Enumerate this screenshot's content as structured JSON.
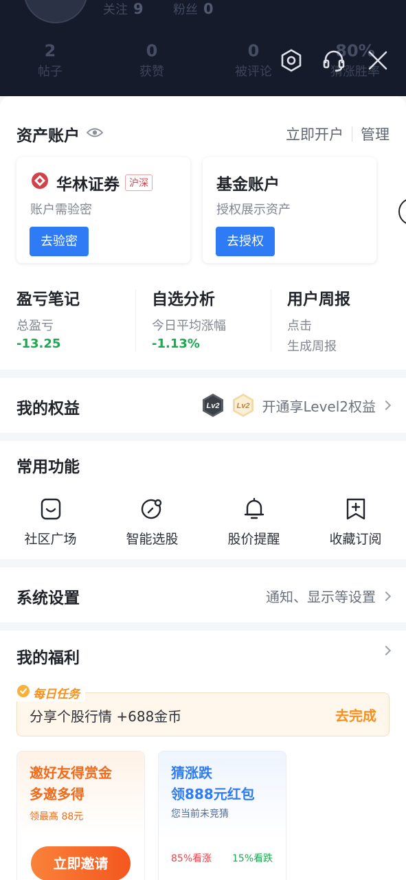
{
  "header": {
    "follow_label": "关注",
    "follow_count": "9",
    "fans_label": "粉丝",
    "fans_count": "0",
    "stats": [
      {
        "num": "2",
        "label": "帖子"
      },
      {
        "num": "0",
        "label": "获赞"
      },
      {
        "num": "0",
        "label": "被评论"
      },
      {
        "num": "80%",
        "label": "猜涨胜率"
      }
    ]
  },
  "assets": {
    "title": "资产账户",
    "open_link": "立即开户",
    "manage_link": "管理",
    "accounts": [
      {
        "name": "华林证券",
        "tag": "沪深",
        "sub": "账户需验密",
        "button": "去验密"
      },
      {
        "name": "基金账户",
        "sub": "授权展示资产",
        "button": "去授权"
      }
    ],
    "mini": [
      {
        "title": "盈亏笔记",
        "sub": "总盈亏",
        "value": "-13.25"
      },
      {
        "title": "自选分析",
        "sub": "今日平均涨幅",
        "value": "-1.13%"
      },
      {
        "title": "用户周报",
        "sub": "点击",
        "sub2": "生成周报"
      }
    ]
  },
  "rights": {
    "title": "我的权益",
    "action": "开通享Level2权益",
    "badge": "Lv2"
  },
  "functions": {
    "title": "常用功能",
    "items": [
      {
        "label": "社区广场",
        "icon": "community-icon"
      },
      {
        "label": "智能选股",
        "icon": "stock-picker-icon"
      },
      {
        "label": "股价提醒",
        "icon": "bell-icon"
      },
      {
        "label": "收藏订阅",
        "icon": "bookmark-icon"
      }
    ]
  },
  "settings": {
    "title": "系统设置",
    "action": "通知、显示等设置"
  },
  "welfare": {
    "title": "我的福利",
    "task_label": "每日任务",
    "task_text": "分享个股行情 +688金币",
    "task_go": "去完成",
    "promos": [
      {
        "line1": "邀好友得赏金",
        "line2": "多邀多得",
        "sub": "领最高 88元",
        "button": "立即邀请"
      },
      {
        "line1": "猜涨跌",
        "line2": "领888元红包",
        "sub": "您当前未竞猜",
        "up": "85%看涨",
        "down": "15%看跌"
      }
    ]
  },
  "colors": {
    "header_bg": "#161b2b",
    "primary_blue": "#2f7bf5",
    "loss_green": "#1ba84f",
    "orange": "#f5901e",
    "red_tag": "#d0434b"
  }
}
